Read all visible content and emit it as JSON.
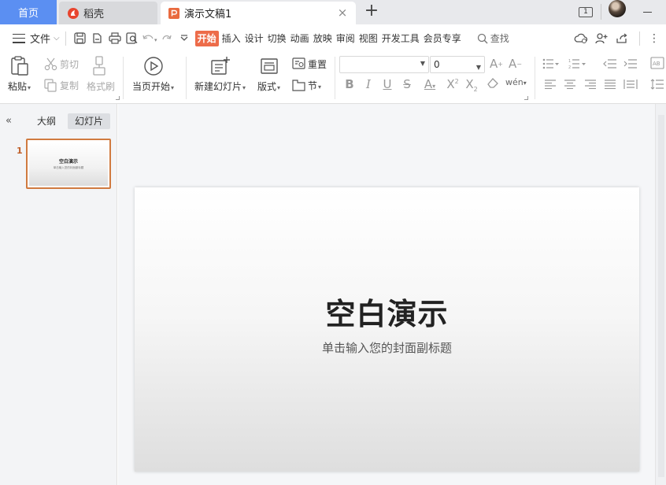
{
  "tabs": {
    "home_label": "首页",
    "docer_label": "稻壳",
    "doc_label": "演示文稿1",
    "close_glyph": "×",
    "add_glyph": "+"
  },
  "titlebar": {
    "screen_badge": "1"
  },
  "menubar": {
    "file_label": "文件",
    "tabs": [
      "开始",
      "插入",
      "设计",
      "切换",
      "动画",
      "放映",
      "审阅",
      "视图",
      "开发工具",
      "会员专享"
    ],
    "active_tab": "开始",
    "search_label": "查找"
  },
  "ribbon": {
    "paste": "粘贴",
    "cut": "剪切",
    "copy": "复制",
    "format_painter": "格式刷",
    "play_from_current": "当页开始",
    "new_slide": "新建幻灯片",
    "layout": "版式",
    "reset": "重置",
    "section": "节",
    "font_name": "",
    "font_size": "0"
  },
  "leftpanel": {
    "outline_tab": "大纲",
    "slides_tab": "幻灯片",
    "active_tab": "幻灯片",
    "slide_number": "1"
  },
  "slide": {
    "title": "空白演示",
    "subtitle": "单击输入您的封面副标题"
  },
  "colors": {
    "accent": "#ed6c4a",
    "home_tab": "#5b8ff2",
    "selection": "#d07a3f"
  }
}
